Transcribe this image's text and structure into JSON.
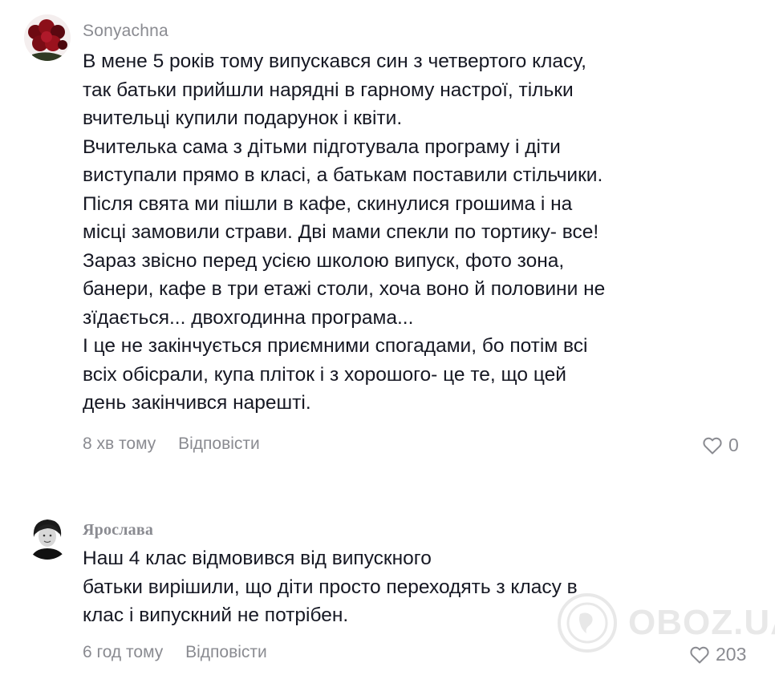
{
  "comments": [
    {
      "username": "Sonyachna",
      "avatar_icon": "roses-avatar-icon",
      "lines": [
        "В мене 5 років тому випускався син з четвертого класу,",
        "так батьки прийшли нарядні в гарному настрої, тільки",
        "вчительці купили подарунок і квіти.",
        "Вчителька сама з дітьми підготувала програму і діти",
        "виступали прямо в класі, а батькам поставили стільчики.",
        "Після свята ми пішли в кафе, скинулися грошима і на",
        "місці замовили страви. Дві мами спекли по тортику- все!",
        "Зараз звісно перед усією школою випуск, фото зона,",
        "банери, кафе в три етажі столи, хоча воно й половини не",
        "зїдається... двохгодинна програма...",
        "І це не закінчується приємними спогадами, бо потім всі",
        "всіх обісрали, купа пліток і з хорошого- це те, що цей",
        "день закінчився нарешті."
      ],
      "time": "8 хв тому",
      "reply_label": "Відповісти",
      "likes": "0"
    },
    {
      "username": "Ярослава",
      "avatar_icon": "woman-portrait-avatar-icon",
      "lines": [
        "Наш 4 клас відмовився від випускного",
        "батьки вирішили, що діти просто переходять з класу в",
        "клас і випускний не потрібен."
      ],
      "time": "6 год тому",
      "reply_label": "Відповісти",
      "likes": "203"
    }
  ],
  "watermark": {
    "text": "OBOZ.UA",
    "icon": "globe-logo-icon"
  },
  "colors": {
    "text": "#161823",
    "muted": "#8a8b91",
    "background": "#ffffff"
  }
}
